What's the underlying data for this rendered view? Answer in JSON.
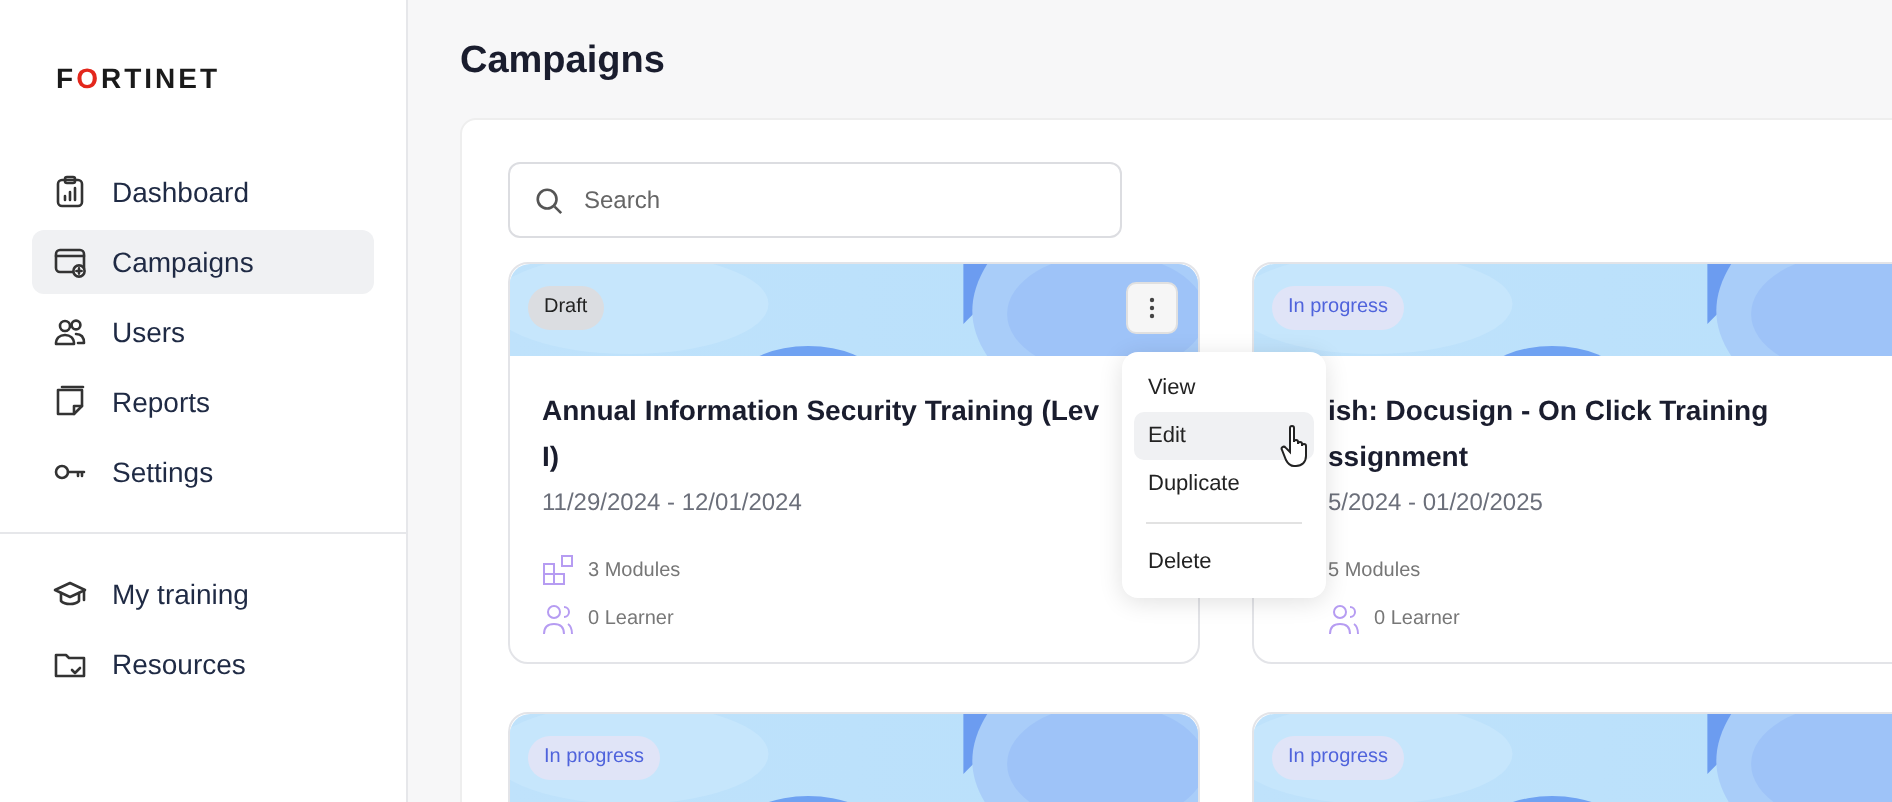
{
  "sidebar": {
    "logo": "FORTINET",
    "items": [
      {
        "label": "Dashboard",
        "selected": false
      },
      {
        "label": "Campaigns",
        "selected": true
      },
      {
        "label": "Users",
        "selected": false
      },
      {
        "label": "Reports",
        "selected": false
      },
      {
        "label": "Settings",
        "selected": false
      }
    ],
    "footer_items": [
      {
        "label": "My training",
        "selected": false
      },
      {
        "label": "Resources",
        "selected": false
      }
    ]
  },
  "page": {
    "title": "Campaigns"
  },
  "search": {
    "placeholder": "Search"
  },
  "cards": [
    {
      "status": "Draft",
      "color": "#222222",
      "title_lines": [
        "Annual Information Security Training (Lev",
        "I)"
      ],
      "dates": "11/29/2024 - 12/01/2024",
      "modules": "3 Modules",
      "learners": "0 Learner",
      "menu_open": true
    },
    {
      "status": "In progress",
      "color": "#4f63dc",
      "title_lines": [
        "ish: Docusign - On Click Training",
        "ssignment"
      ],
      "dates": "5/2024 - 01/20/2025",
      "modules": "5 Modules",
      "learners": "0 Learner",
      "menu_open": false
    },
    {
      "status": "In progress",
      "color": "#4f63dc",
      "menu_open": false
    },
    {
      "status": "In progress",
      "color": "#4f63dc",
      "menu_open": false
    }
  ],
  "menu": {
    "items": [
      {
        "label": "View",
        "hovered": false
      },
      {
        "label": "Edit",
        "hovered": true
      },
      {
        "label": "Duplicate",
        "hovered": false
      },
      {
        "label": "Delete",
        "hovered": false
      }
    ]
  }
}
